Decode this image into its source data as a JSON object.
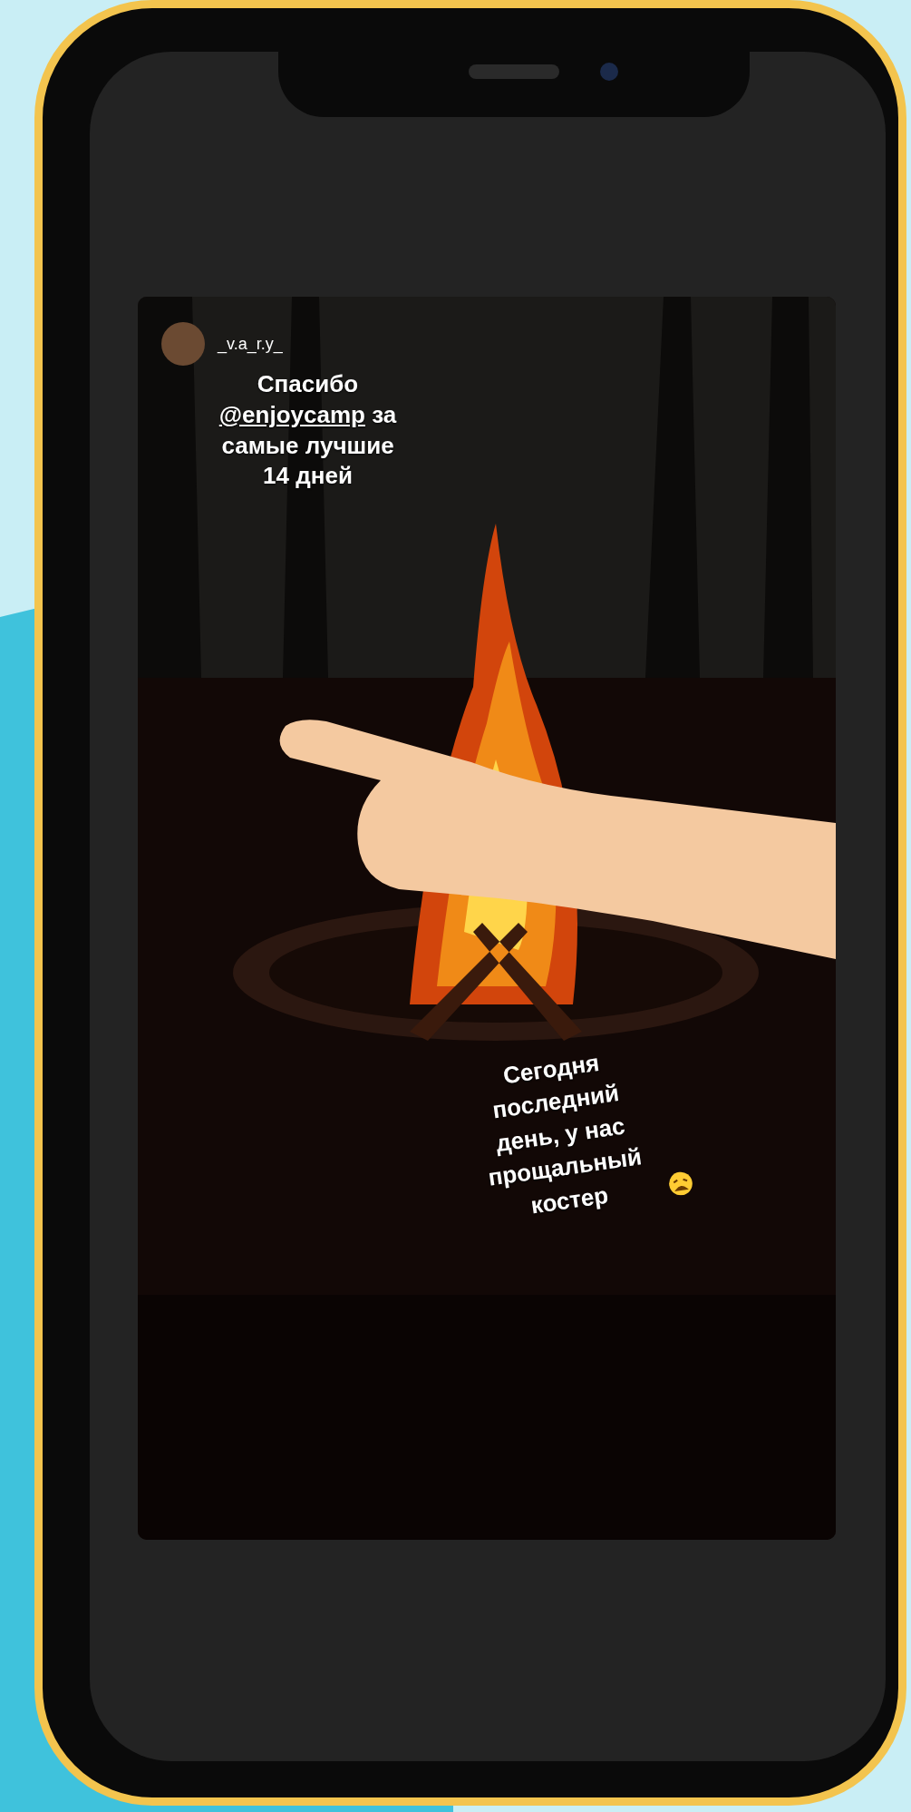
{
  "story": {
    "username": "_v.a_r.y_",
    "caption_top": {
      "before": "Спасибо",
      "mention": "@enjoycamp",
      "after": "за самые лучшие 14 дней"
    },
    "caption_bottom": {
      "text": "Сегодня последний день, у нас прощальный костер"
    }
  }
}
